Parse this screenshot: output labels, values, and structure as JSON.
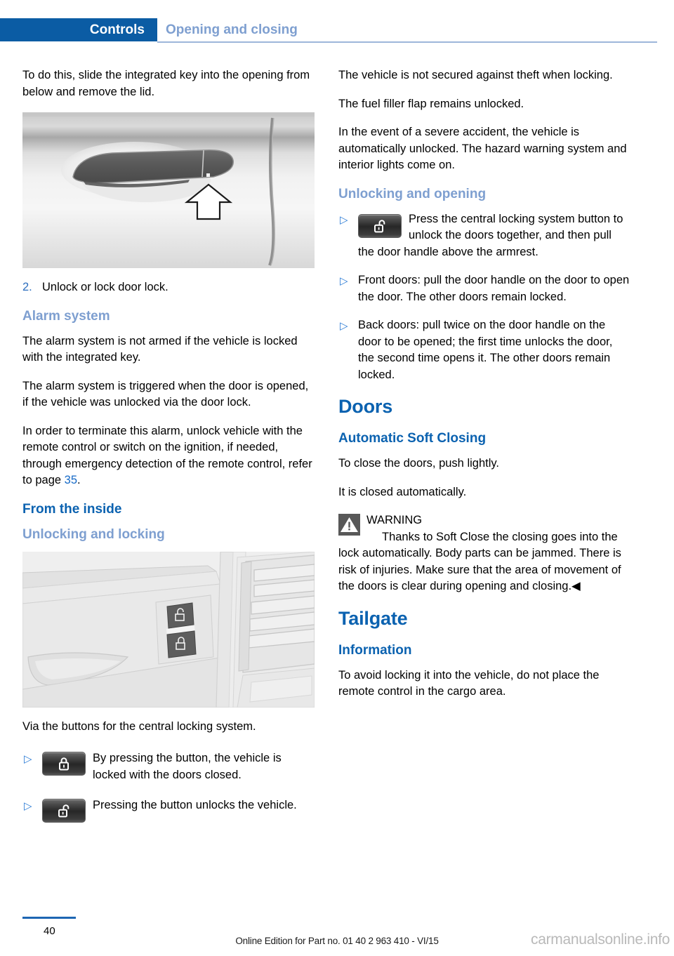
{
  "header": {
    "chapter": "Controls",
    "section": "Opening and closing"
  },
  "left_column": {
    "intro_paragraph": "To do this, slide the integrated key into the opening from below and remove the lid.",
    "figure_door_handle_alt": "Exterior car door handle with upward arrow indicating lock cover opening",
    "step": {
      "number": "2.",
      "text": "Unlock or lock door lock."
    },
    "alarm_heading": "Alarm system",
    "alarm_p1": "The alarm system is not armed if the vehicle is locked with the integrated key.",
    "alarm_p2": "The alarm system is triggered when the door is opened, if the vehicle was unlocked via the door lock.",
    "alarm_p3_before": "In order to terminate this alarm, unlock vehicle with the remote control or switch on the ignition, if needed, through emergency detection of the remote control, refer to page ",
    "alarm_p3_page": "35",
    "alarm_p3_after": ".",
    "from_inside_heading": "From the inside",
    "unlocking_locking_heading": "Unlocking and locking",
    "figure_interior_alt": "Interior door panel showing central locking lock and unlock buttons next to air vent",
    "via_buttons_text": "Via the buttons for the central locking system.",
    "bullets": [
      {
        "marker": "▷",
        "icon": "lock-closed-icon",
        "text": "By pressing the button, the vehicle is locked with the doors closed."
      },
      {
        "marker": "▷",
        "icon": "lock-open-icon",
        "text": "Pressing the button unlocks the vehicle."
      }
    ]
  },
  "right_column": {
    "p1": "The vehicle is not secured against theft when locking.",
    "p2": "The fuel filler flap remains unlocked.",
    "p3": "In the event of a severe accident, the vehicle is automatically unlocked. The hazard warning system and interior lights come on.",
    "unlocking_opening_heading": "Unlocking and opening",
    "bullets": [
      {
        "marker": "▷",
        "icon": "lock-open-icon",
        "text": "Press the central locking system button to unlock the doors together, and then pull the door handle above the armrest."
      },
      {
        "marker": "▷",
        "icon": null,
        "text": "Front doors: pull the door handle on the door to open the door. The other doors remain locked."
      },
      {
        "marker": "▷",
        "icon": null,
        "text": "Back doors: pull twice on the door handle on the door to be opened; the first time unlocks the door, the second time opens it. The other doors remain locked."
      }
    ],
    "doors_heading": "Doors",
    "soft_closing_heading": "Automatic Soft Closing",
    "soft_p1": "To close the doors, push lightly.",
    "soft_p2": "It is closed automatically.",
    "warning": {
      "icon": "warning-triangle-icon",
      "title": "WARNING",
      "text": "Thanks to Soft Close the closing goes into the lock automatically. Body parts can be jammed. There is risk of injuries. Make sure that the area of movement of the doors is clear during opening and closing.",
      "end_marker": "◀"
    },
    "tailgate_heading": "Tailgate",
    "information_heading": "Information",
    "info_p1": "To avoid locking it into the vehicle, do not place the remote control in the cargo area."
  },
  "footer": {
    "page_number": "40",
    "edition_text": "Online Edition for Part no. 01 40 2 963 410 - VI/15",
    "watermark": "carmanualsonline.info"
  },
  "colors": {
    "header_blue": "#0B5CA4",
    "heading_blue": "#0B62B0",
    "light_blue": "#7E9FD0",
    "link_blue": "#1569C7",
    "bullet_blue": "#2E7DD6"
  }
}
